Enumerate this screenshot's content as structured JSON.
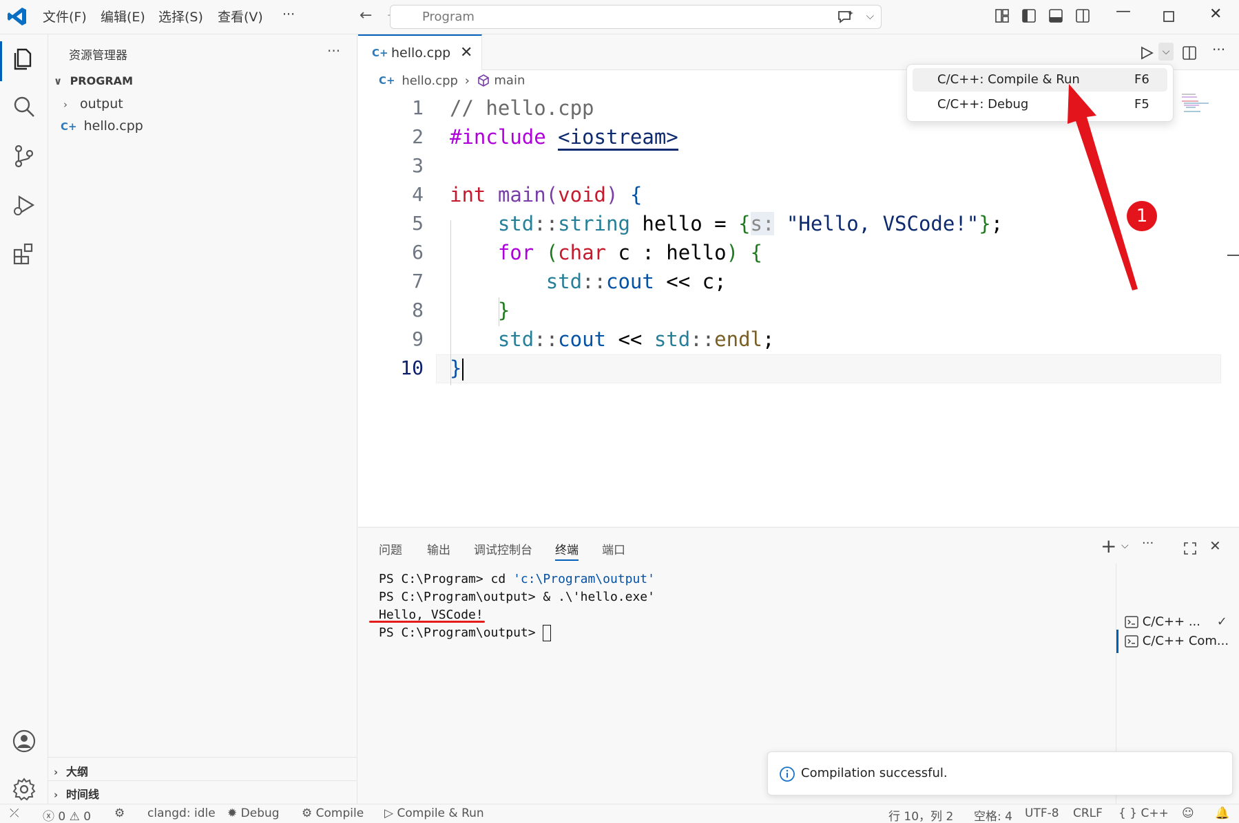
{
  "titlebar": {
    "menu": [
      "文件(F)",
      "编辑(E)",
      "选择(S)",
      "查看(V)",
      "···"
    ],
    "command_center": "Program"
  },
  "sidebar": {
    "title": "资源管理器",
    "more": "···",
    "root": "PROGRAM",
    "items": [
      {
        "label": "output",
        "type": "folder"
      },
      {
        "label": "hello.cpp",
        "type": "file"
      }
    ],
    "outline": "大纲",
    "timeline": "时间线"
  },
  "editor": {
    "tab_label": "hello.cpp",
    "breadcrumb_file": "hello.cpp",
    "breadcrumb_symbol": "main",
    "line_numbers": [
      "1",
      "2",
      "3",
      "4",
      "5",
      "6",
      "7",
      "8",
      "9",
      "10"
    ]
  },
  "code": {
    "l1_comment": "// hello.cpp",
    "l2_pre": "#include",
    "l2_inc": "<iostream>",
    "l4_int": "int",
    "l4_main": "main",
    "l4_paren": "(",
    "l4_void": "void",
    "l4_close": ")",
    "l4_brace": "{",
    "l5_ns": "std",
    "l5_sep": "::",
    "l5_type": "string",
    "l5_var": " hello = ",
    "l5_brace": "{",
    "l5_hint": "s:",
    "l5_str": " \"Hello, VSCode!\"",
    "l5_brace2": "}",
    "l5_end": ";",
    "l6_for": "for",
    "l6_p": " (",
    "l6_char": "char",
    "l6_rest": " c : hello",
    "l6_p2": ")",
    "l6_brace": " {",
    "l7_ns": "std",
    "l7_sep": "::",
    "l7_cout": "cout",
    "l7_rest": " << c;",
    "l8_brace": "}",
    "l9_ns": "std",
    "l9_sep": "::",
    "l9_cout": "cout",
    "l9_mid": " << ",
    "l9_ns2": "std",
    "l9_sep2": "::",
    "l9_endl": "endl",
    "l9_end": ";",
    "l10_brace": "}"
  },
  "run_dropdown": {
    "items": [
      {
        "label": "C/C++: Compile & Run",
        "key": "F6"
      },
      {
        "label": "C/C++: Debug",
        "key": "F5"
      }
    ]
  },
  "annotation": {
    "badge": "1"
  },
  "panel": {
    "tabs": [
      "问题",
      "输出",
      "调试控制台",
      "终端",
      "端口"
    ],
    "terminal_lines": {
      "l1_prompt": "PS C:\\Program> cd ",
      "l1_str": "'c:\\Program\\output'",
      "l2_prompt": "PS C:\\Program\\output> & .\\",
      "l2_str": "'hello.exe'",
      "l3": "Hello, VSCode!",
      "l4_prompt": "PS C:\\Program\\output> "
    },
    "terminals": [
      "C/C++ ...",
      "C/C++ Com..."
    ],
    "actions": {
      "plus": "+",
      "more": "···",
      "close": "✕"
    }
  },
  "notification": {
    "text": "Compilation successful."
  },
  "statusbar": {
    "errors": "0",
    "warnings": "0",
    "clangd": "clangd: idle",
    "debug": "Debug",
    "compile": "Compile",
    "compile_run": "Compile & Run",
    "position": "行 10，列 2",
    "spaces": "空格: 4",
    "encoding": "UTF-8",
    "eol": "CRLF",
    "language": "C++"
  },
  "colors": {
    "accent": "#005fb8",
    "annotation_red": "#e3141b"
  }
}
